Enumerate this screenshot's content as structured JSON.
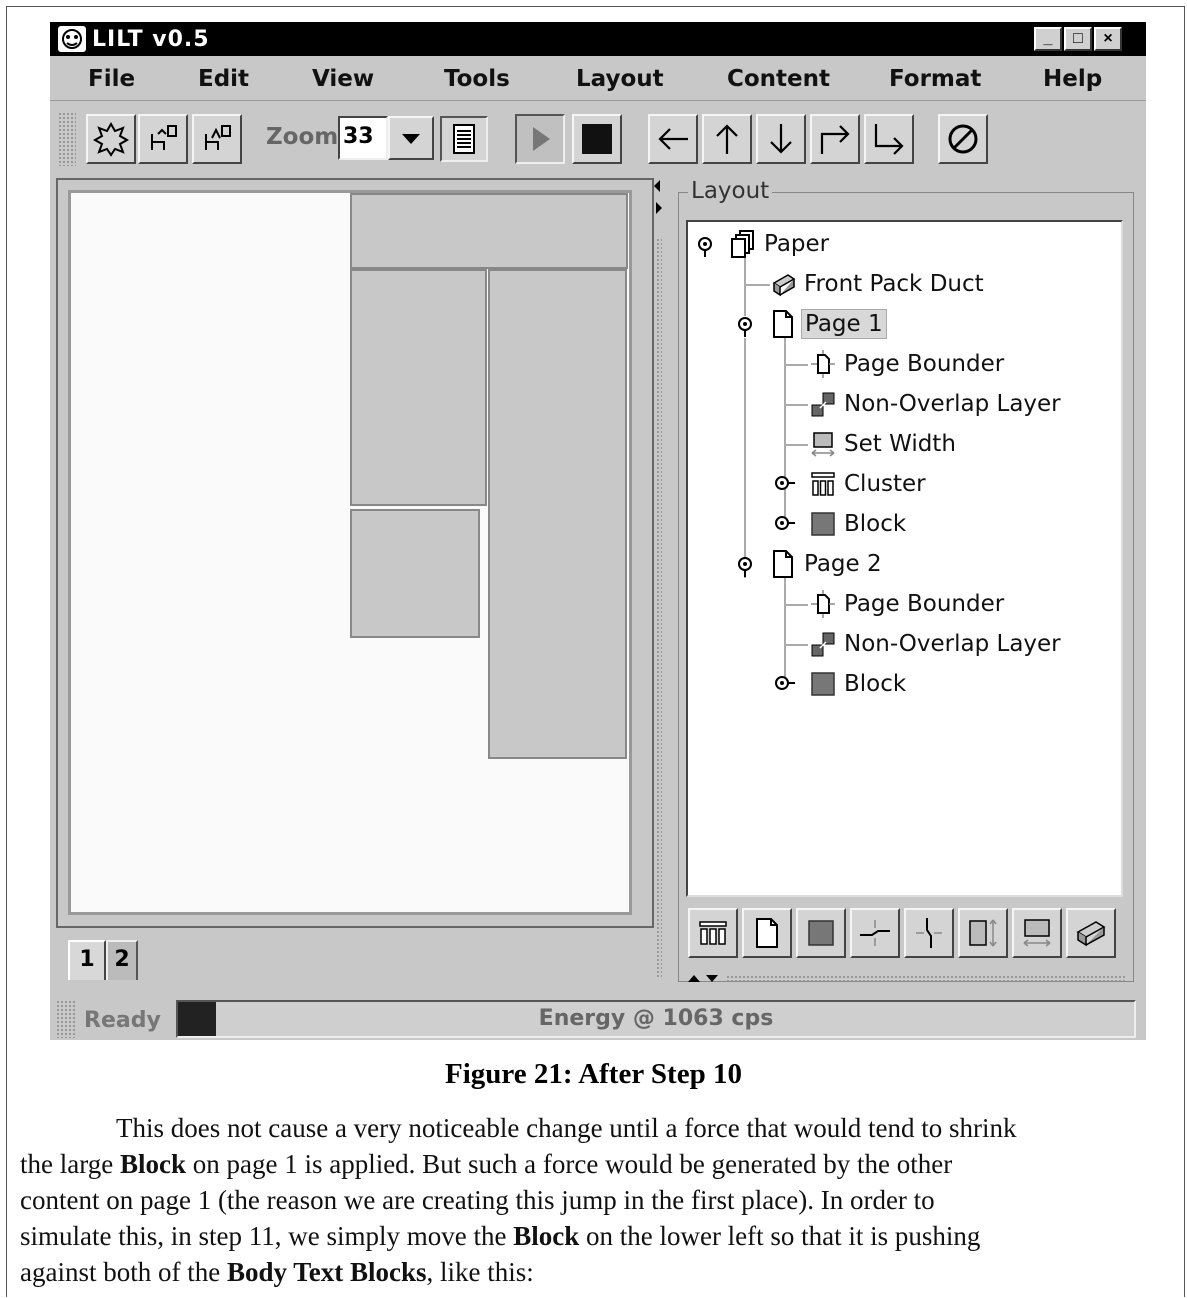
{
  "window": {
    "title": "LILT v0.5"
  },
  "menu": [
    "File",
    "Edit",
    "View",
    "Tools",
    "Layout",
    "Content",
    "Format",
    "Help"
  ],
  "toolbar": {
    "zoom_label": "Zoom:",
    "zoom_value": "33"
  },
  "page_tabs": [
    "1",
    "2"
  ],
  "layout_panel": {
    "group_label": "Layout",
    "tree": [
      {
        "label": "Paper",
        "icon": "pages-icon"
      },
      {
        "label": "Front Pack Duct",
        "icon": "duct-icon"
      },
      {
        "label": "Page 1",
        "icon": "page-icon",
        "selected": true
      },
      {
        "label": "Page Bounder",
        "icon": "page-bounder-icon"
      },
      {
        "label": "Non-Overlap Layer",
        "icon": "non-overlap-icon"
      },
      {
        "label": "Set Width",
        "icon": "set-width-icon"
      },
      {
        "label": "Cluster",
        "icon": "cluster-icon"
      },
      {
        "label": "Block",
        "icon": "block-icon"
      },
      {
        "label": "Page 2",
        "icon": "page-icon"
      },
      {
        "label": "Page Bounder",
        "icon": "page-bounder-icon"
      },
      {
        "label": "Non-Overlap Layer",
        "icon": "non-overlap-icon"
      },
      {
        "label": "Block",
        "icon": "block-icon"
      }
    ]
  },
  "status": {
    "ready": "Ready",
    "energy": "Energy @ 1063 cps",
    "energy_level": 0.04
  },
  "caption": "Figure 21: After Step 10",
  "paragraph": {
    "line1": "This does not cause a very noticeable change until a force that would tend to shrink",
    "line2_a": "the large ",
    "line2_b": "Block",
    "line2_c": " on page 1 is applied.  But such a force would be generated by the other",
    "line3": "content on page 1 (the reason we are creating this jump in the first place).  In order to",
    "line4_a": "simulate this, in step 11, we simply move the ",
    "line4_b": "Block",
    "line4_c": " on the lower left so that it is pushing",
    "line5_a": "against both of the ",
    "line5_b": "Body Text Blocks",
    "line5_c": ", like this:"
  }
}
